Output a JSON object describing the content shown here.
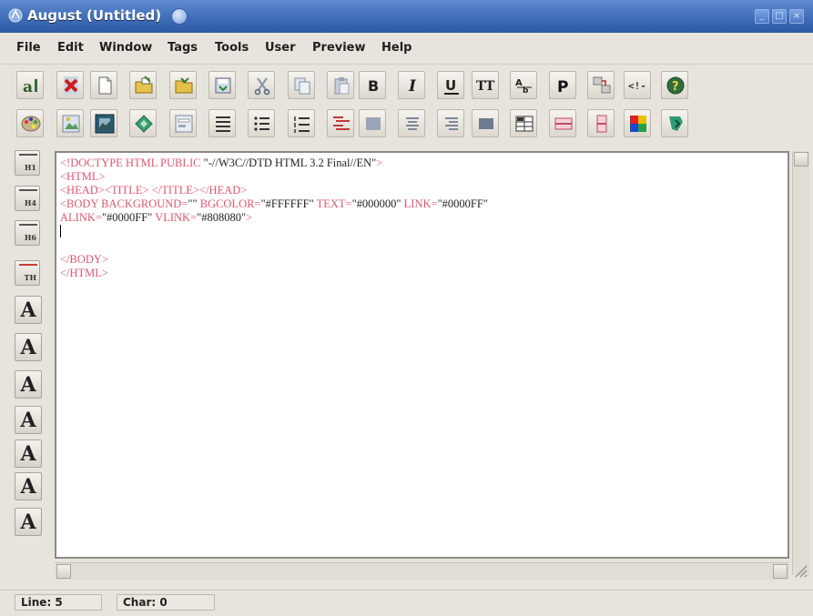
{
  "window": {
    "title": "August (Untitled)",
    "buttons": [
      "_",
      "□",
      "×"
    ]
  },
  "menu": {
    "items": [
      "File",
      "Edit",
      "Window",
      "Tags",
      "Tools",
      "User",
      "Preview",
      "Help"
    ]
  },
  "toolbar1": {
    "icons": [
      "august-logo-icon",
      "close-file-icon",
      "new-file-icon",
      "open-file-icon",
      "open-folder-icon",
      "save-file-icon",
      "cut-icon",
      "copy-icon",
      "paste-icon",
      "bold-icon",
      "italic-icon",
      "underline-icon",
      "teletype-icon",
      "subscript-icon",
      "paragraph-icon",
      "link-icon",
      "comment-icon",
      "help-icon"
    ],
    "labels": {
      "bold": "B",
      "italic": "I",
      "underline": "U",
      "teletype": "TT",
      "paragraph": "P",
      "comment": "<!-"
    }
  },
  "toolbar2": {
    "icons": [
      "color-palette-icon",
      "image-icon",
      "picture-frame-icon",
      "anchor-diamond-icon",
      "form-icon",
      "list-icon",
      "unordered-list-icon",
      "ordered-list-icon",
      "definition-list-icon",
      "menu-list-icon",
      "align-left-icon",
      "align-center-icon",
      "align-right-icon",
      "block-icon",
      "table-icon",
      "table-row-icon",
      "table-cell-icon",
      "colors-icon",
      "tree-icon"
    ]
  },
  "left_palette": {
    "headings": [
      {
        "icon": "heading-1-icon",
        "label": "H1"
      },
      {
        "icon": "heading-2-icon",
        "label": "H4"
      },
      {
        "icon": "heading-3-icon",
        "label": "H6"
      },
      {
        "icon": "table-heading-icon",
        "label": "TH"
      }
    ],
    "font_buttons": [
      "A",
      "A",
      "A",
      "A",
      "A",
      "A",
      "A"
    ]
  },
  "editor": {
    "lines": [
      [
        {
          "t": "<!DOCTYPE HTML PUBLIC ",
          "c": "tag"
        },
        {
          "t": "\"-//W3C//DTD HTML 3.2 Final//EN\"",
          "c": "val"
        },
        {
          "t": ">",
          "c": "tag"
        }
      ],
      [
        {
          "t": "<HTML>",
          "c": "tag"
        }
      ],
      [
        {
          "t": "<HEAD><TITLE> </TITLE></HEAD>",
          "c": "tag"
        }
      ],
      [
        {
          "t": "<BODY BACKGROUND=",
          "c": "tag"
        },
        {
          "t": "\"\"",
          "c": "val"
        },
        {
          "t": " BGCOLOR=",
          "c": "tag"
        },
        {
          "t": "\"#FFFFFF\"",
          "c": "val"
        },
        {
          "t": " TEXT=",
          "c": "tag"
        },
        {
          "t": "\"#000000\"",
          "c": "val"
        },
        {
          "t": " LINK=",
          "c": "tag"
        },
        {
          "t": "\"#0000FF\"",
          "c": "val"
        }
      ],
      [
        {
          "t": "ALINK=",
          "c": "tag"
        },
        {
          "t": "\"#0000FF\"",
          "c": "val"
        },
        {
          "t": " VLINK=",
          "c": "tag"
        },
        {
          "t": "\"#808080\"",
          "c": "val"
        },
        {
          "t": ">",
          "c": "tag"
        }
      ],
      [],
      [],
      [
        {
          "t": "</BODY>",
          "c": "tag"
        }
      ],
      [
        {
          "t": "</HTML>",
          "c": "tag"
        }
      ]
    ],
    "tag_color": "#e2566e",
    "value_color": "#222222"
  },
  "status": {
    "line": "Line: 5",
    "char": "Char: 0"
  },
  "colors": {
    "titlebar": "#3f6db8",
    "background": "#e7e4dd"
  }
}
